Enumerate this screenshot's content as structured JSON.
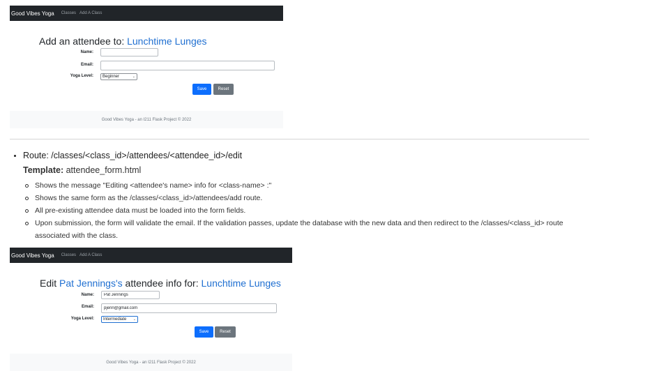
{
  "screenshot1": {
    "brand": "Good Vibes Yoga",
    "nav": [
      "Classes",
      "Add A Class"
    ],
    "title_prefix": "Add an attendee to: ",
    "class_name": "Lunchtime Lunges",
    "labels": {
      "name": "Name:",
      "email": "Email:",
      "level": "Yoga Level:"
    },
    "values": {
      "name": "",
      "email": "",
      "level": "Beginner"
    },
    "buttons": {
      "save": "Save",
      "reset": "Reset"
    },
    "footer": "Good Vibes Yoga - an I211 Flask Project © 2022"
  },
  "instructions": {
    "route": "Route: /classes/<class_id>/attendees/<attendee_id>/edit",
    "template_label": "Template:",
    "template_value": " attendee_form.html",
    "notes": [
      "Shows the message \"Editing <attendee's name> info for <class-name> :\"",
      "Shows the same form as the /classes/<class_id>/attendees/add route.",
      "All pre-existing attendee data must be loaded into the form fields.",
      "Upon submission, the form will validate the email. If the validation passes, update the database with the new data and then redirect to the /classes/<class_id> route associated with the class."
    ]
  },
  "screenshot2": {
    "brand": "Good Vibes Yoga",
    "nav": [
      "Classes",
      "Add A Class"
    ],
    "title_prefix": "Edit ",
    "attendee_name": "Pat Jennings's",
    "title_middle": " attendee info for: ",
    "class_name": "Lunchtime Lunges",
    "labels": {
      "name": "Name:",
      "email": "Email:",
      "level": "Yoga Level:"
    },
    "values": {
      "name": "Pat Jennings",
      "email": "pjenn@gmail.com",
      "level": "Intermediate"
    },
    "buttons": {
      "save": "Save",
      "reset": "Reset"
    },
    "footer": "Good Vibes Yoga - an I211 Flask Project © 2022"
  },
  "colors": {
    "navbar": "#212529",
    "accent": "#1f6fd1",
    "primary": "#0d6efd",
    "secondary": "#6c757d",
    "footer_bg": "#f8f9fa"
  }
}
